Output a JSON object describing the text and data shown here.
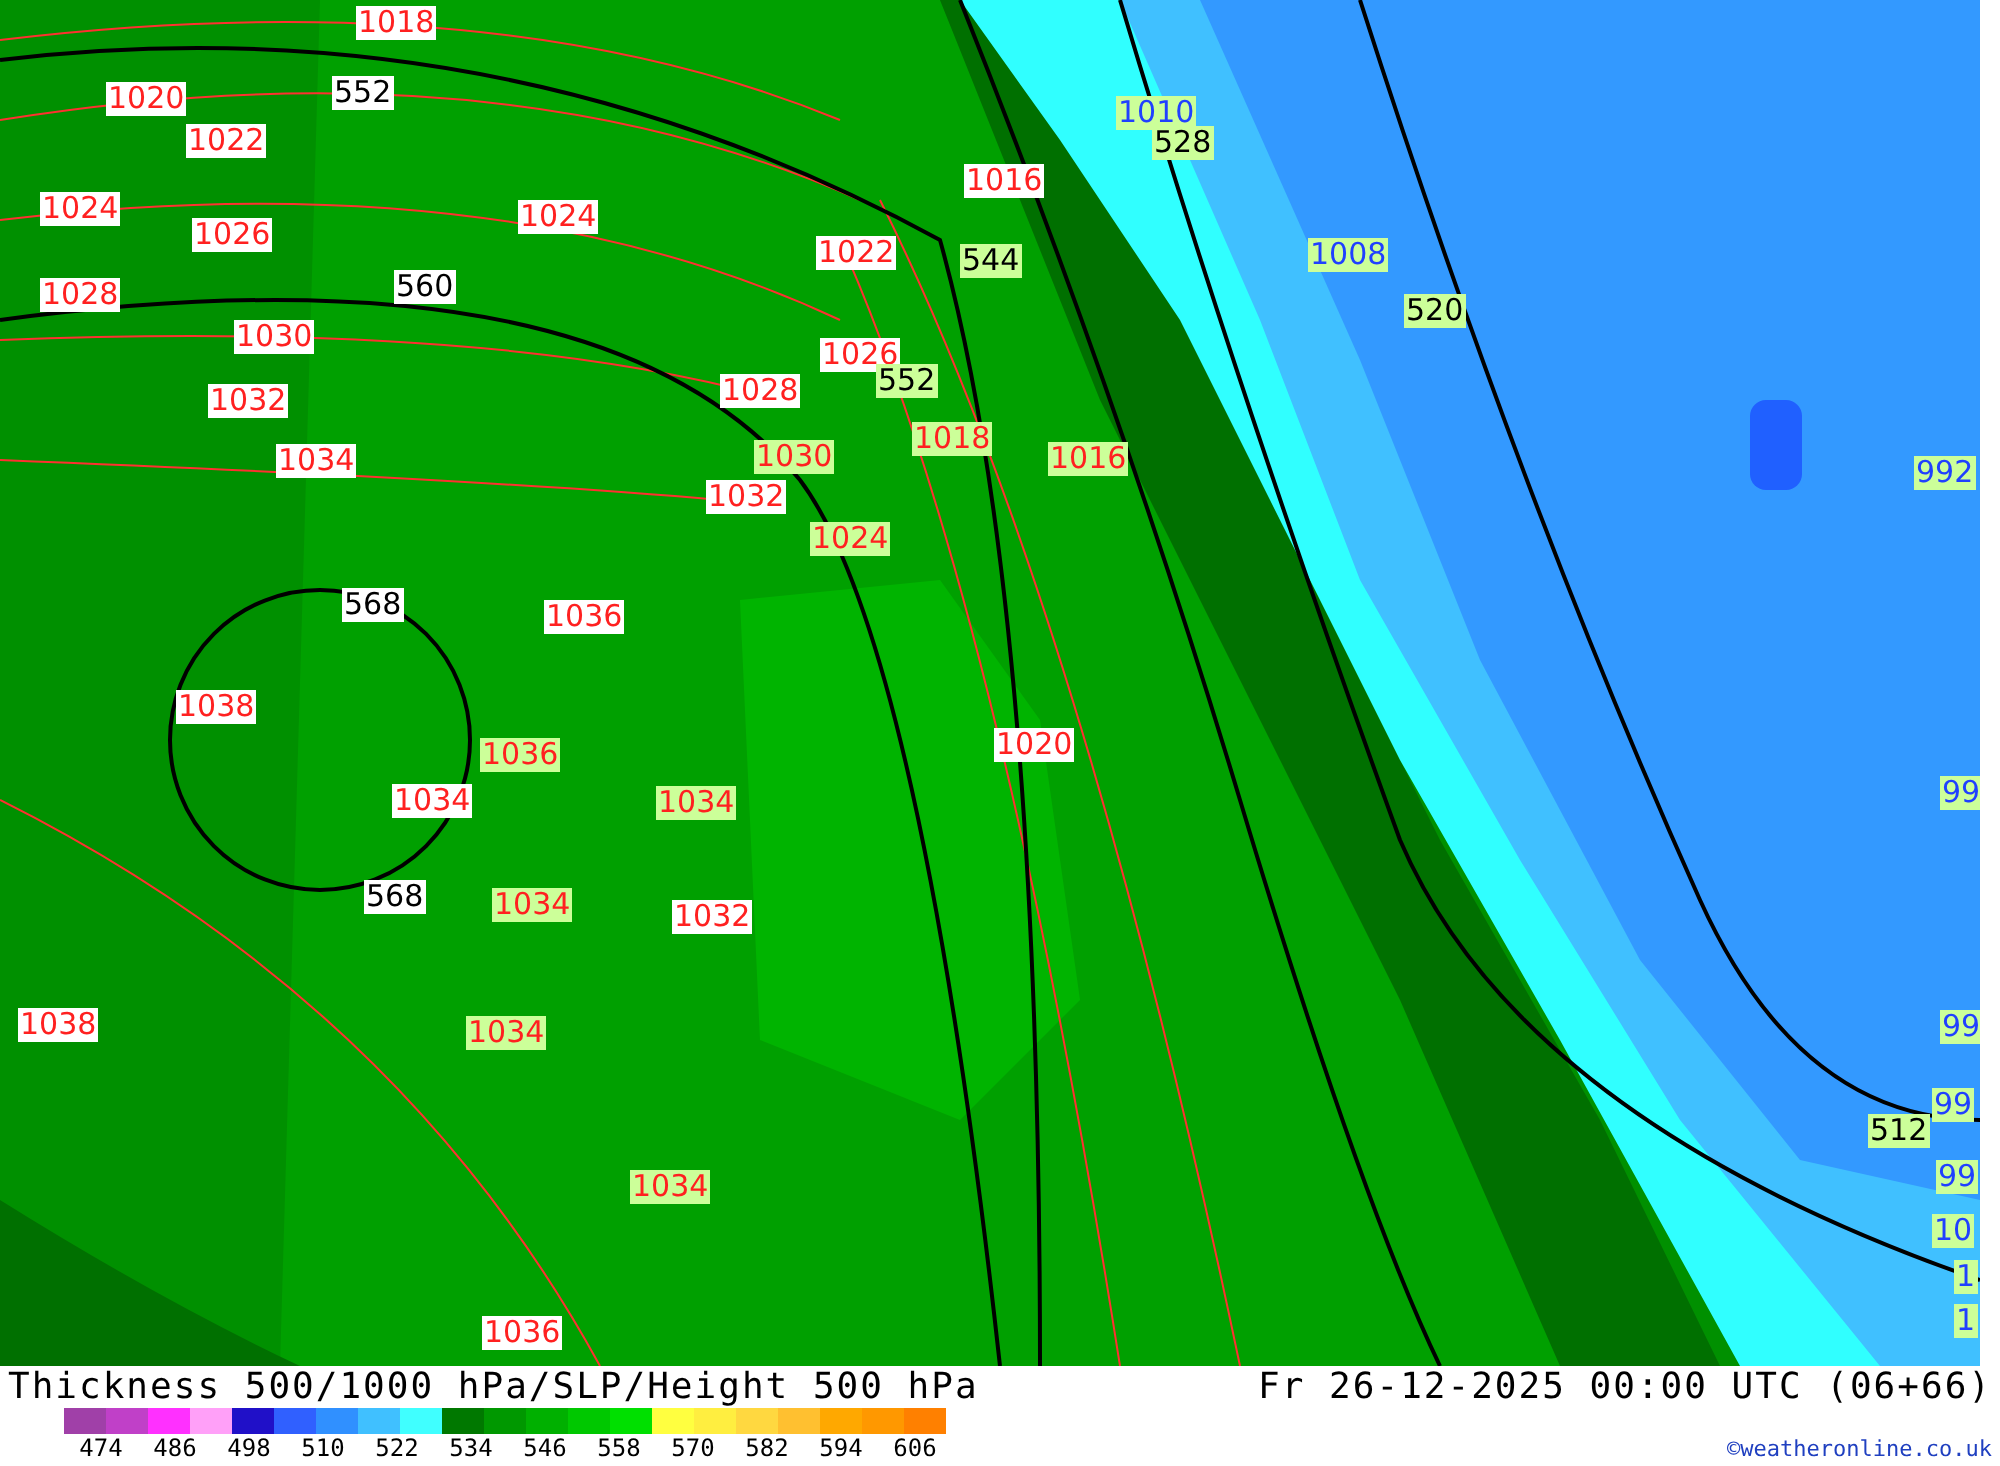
{
  "map": {
    "labels": [
      {
        "text": "1018",
        "kind": "slp"
      },
      {
        "text": "1020",
        "kind": "slp"
      },
      {
        "text": "552",
        "kind": "height"
      },
      {
        "text": "1022",
        "kind": "slp"
      },
      {
        "text": "1024",
        "kind": "slp"
      },
      {
        "text": "1026",
        "kind": "slp"
      },
      {
        "text": "1024",
        "kind": "slp"
      },
      {
        "text": "1028",
        "kind": "slp"
      },
      {
        "text": "560",
        "kind": "height"
      },
      {
        "text": "1030",
        "kind": "slp"
      },
      {
        "text": "1032",
        "kind": "slp"
      },
      {
        "text": "1034",
        "kind": "slp"
      },
      {
        "text": "1028",
        "kind": "slp"
      },
      {
        "text": "1030",
        "kind": "slp"
      },
      {
        "text": "1032",
        "kind": "slp"
      },
      {
        "text": "568",
        "kind": "height"
      },
      {
        "text": "1036",
        "kind": "slp"
      },
      {
        "text": "1038",
        "kind": "slp"
      },
      {
        "text": "1036",
        "kind": "slp"
      },
      {
        "text": "1034",
        "kind": "slp"
      },
      {
        "text": "1034",
        "kind": "slp"
      },
      {
        "text": "568",
        "kind": "height"
      },
      {
        "text": "1034",
        "kind": "slp"
      },
      {
        "text": "1032",
        "kind": "slp"
      },
      {
        "text": "1038",
        "kind": "slp"
      },
      {
        "text": "1034",
        "kind": "slp"
      },
      {
        "text": "1034",
        "kind": "slp"
      },
      {
        "text": "1036",
        "kind": "slp"
      },
      {
        "text": "1022",
        "kind": "slp"
      },
      {
        "text": "1026",
        "kind": "slp"
      },
      {
        "text": "552",
        "kind": "height"
      },
      {
        "text": "1016",
        "kind": "slp"
      },
      {
        "text": "544",
        "kind": "height"
      },
      {
        "text": "1018",
        "kind": "slp"
      },
      {
        "text": "1016",
        "kind": "slp"
      },
      {
        "text": "1024",
        "kind": "slp"
      },
      {
        "text": "1020",
        "kind": "slp"
      },
      {
        "text": "1010",
        "kind": "slp_low"
      },
      {
        "text": "528",
        "kind": "height"
      },
      {
        "text": "1008",
        "kind": "slp_low"
      },
      {
        "text": "520",
        "kind": "height"
      },
      {
        "text": "992",
        "kind": "slp_low"
      },
      {
        "text": "99",
        "kind": "slp_low"
      },
      {
        "text": "99",
        "kind": "slp_low"
      },
      {
        "text": "512",
        "kind": "height"
      },
      {
        "text": "99",
        "kind": "slp_low"
      },
      {
        "text": "99",
        "kind": "slp_low"
      },
      {
        "text": "10",
        "kind": "slp_low"
      },
      {
        "text": "1",
        "kind": "slp_low"
      },
      {
        "text": "1",
        "kind": "slp_low"
      }
    ]
  },
  "footer": {
    "title": "Thickness 500/1000 hPa/SLP/Height 500 hPa",
    "valid_time": "Fr 26-12-2025 00:00 UTC (06+66)",
    "legend": [
      {
        "color": "#a040a8"
      },
      {
        "color": "#c040c8"
      },
      {
        "color": "#ff30ff"
      },
      {
        "color": "#ffa0f8"
      },
      {
        "color": "#2010c8"
      },
      {
        "color": "#3060ff"
      },
      {
        "color": "#3090ff"
      },
      {
        "color": "#40c0ff"
      },
      {
        "color": "#40ffff"
      },
      {
        "color": "#007800"
      },
      {
        "color": "#009800"
      },
      {
        "color": "#00b000"
      },
      {
        "color": "#00c800"
      },
      {
        "color": "#00e000"
      },
      {
        "color": "#ffff40"
      },
      {
        "color": "#ffee40"
      },
      {
        "color": "#ffd840"
      },
      {
        "color": "#ffc030"
      },
      {
        "color": "#ffa800"
      },
      {
        "color": "#ff9800"
      },
      {
        "color": "#ff8000"
      }
    ],
    "ticks": [
      "474",
      "486",
      "498",
      "510",
      "522",
      "534",
      "546",
      "558",
      "570",
      "582",
      "594",
      "606"
    ],
    "credit": "©weatheronline.co.uk"
  }
}
